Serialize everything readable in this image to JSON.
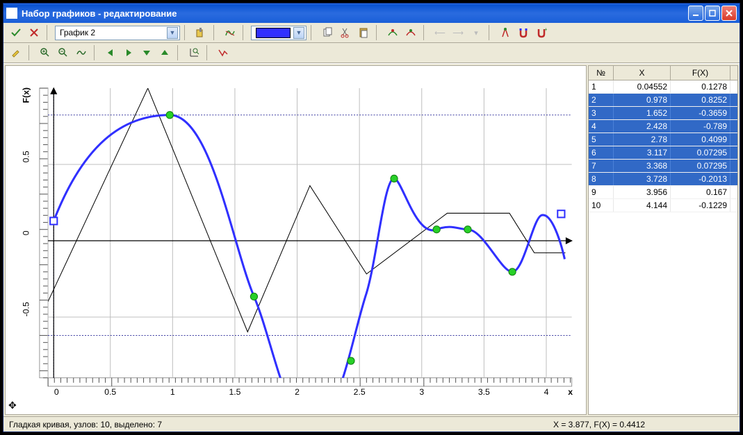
{
  "window": {
    "title": "Набор графиков - редактирование"
  },
  "toolbar1": {
    "graph_selector": "График 2"
  },
  "color": "#3030ff",
  "chart_data": {
    "type": "line",
    "xlabel": "x",
    "ylabel": "F(x)",
    "xlim": [
      0,
      4.2
    ],
    "ylim": [
      -0.9,
      1.0
    ],
    "xticks": [
      0,
      0.5,
      1,
      1.5,
      2,
      2.5,
      3,
      3.5,
      4
    ],
    "yticks": [
      -0.5,
      0,
      0.5
    ],
    "series": [
      {
        "name": "polyline",
        "style": "thin-black",
        "x": [
          0,
          0.8,
          1.6,
          2.1,
          2.55,
          3.2,
          3.7,
          3.9,
          4.15
        ],
        "y": [
          -0.4,
          1.0,
          -0.6,
          0.36,
          -0.22,
          0.18,
          0.18,
          -0.08,
          -0.08
        ]
      },
      {
        "name": "smooth-curve",
        "style": "thick-blue",
        "nodes": [
          {
            "x": 0.04552,
            "y": 0.1278
          },
          {
            "x": 0.978,
            "y": 0.8252
          },
          {
            "x": 1.652,
            "y": -0.3659
          },
          {
            "x": 2.428,
            "y": -0.789
          },
          {
            "x": 2.78,
            "y": 0.4099
          },
          {
            "x": 3.117,
            "y": 0.07295
          },
          {
            "x": 3.368,
            "y": 0.07295
          },
          {
            "x": 3.728,
            "y": -0.2013
          },
          {
            "x": 3.956,
            "y": 0.167
          },
          {
            "x": 4.144,
            "y": -0.1229
          }
        ]
      }
    ],
    "selected_nodes": [
      1,
      2,
      3,
      4,
      5,
      6,
      7
    ],
    "highlight_box_node": 0,
    "cursor_box_node": 9
  },
  "table": {
    "headers": {
      "n": "№",
      "x": "X",
      "fx": "F(X)"
    },
    "rows": [
      {
        "n": "1",
        "x": "0.04552",
        "fx": "0.1278",
        "selected": false
      },
      {
        "n": "2",
        "x": "0.978",
        "fx": "0.8252",
        "selected": true
      },
      {
        "n": "3",
        "x": "1.652",
        "fx": "-0.3659",
        "selected": true
      },
      {
        "n": "4",
        "x": "2.428",
        "fx": "-0.789",
        "selected": true
      },
      {
        "n": "5",
        "x": "2.78",
        "fx": "0.4099",
        "selected": true
      },
      {
        "n": "6",
        "x": "3.117",
        "fx": "0.07295",
        "selected": true
      },
      {
        "n": "7",
        "x": "3.368",
        "fx": "0.07295",
        "selected": true
      },
      {
        "n": "8",
        "x": "3.728",
        "fx": "-0.2013",
        "selected": true
      },
      {
        "n": "9",
        "x": "3.956",
        "fx": "0.167",
        "selected": false
      },
      {
        "n": "10",
        "x": "4.144",
        "fx": "-0.1229",
        "selected": false
      }
    ]
  },
  "status": {
    "left": "Гладкая кривая, узлов: 10, выделено: 7",
    "right": "X = 3.877, F(X) = 0.4412"
  },
  "axis": {
    "xlabel": "x",
    "ylabel": "F(x)",
    "tick_05n": "-0.5",
    "tick_0": "0",
    "tick_05": "0.5",
    "xt_0": "0",
    "xt_05": "0.5",
    "xt_1": "1",
    "xt_15": "1.5",
    "xt_2": "2",
    "xt_25": "2.5",
    "xt_3": "3",
    "xt_35": "3.5",
    "xt_4": "4"
  }
}
